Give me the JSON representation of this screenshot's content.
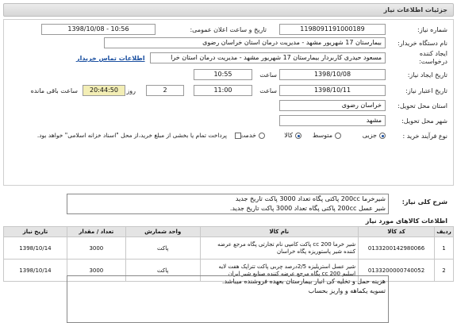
{
  "page_title": "جزئیات اطلاعات نیاز",
  "form": {
    "need_number": {
      "label": "شماره نیاز:",
      "value": "1198091191000189"
    },
    "announce_datetime": {
      "label": "تاریخ و ساعت اعلان عمومی:",
      "value": "1398/10/08 - 10:56"
    },
    "buyer_org": {
      "label": "نام دستگاه خریدار:",
      "value": "بیمارستان 17 شهریور مشهد - مدیریت درمان استان خراسان رضوی"
    },
    "requester": {
      "label_line1": "ایجاد کننده",
      "label_line2": "درخواست:",
      "value": "مسعود حیدری کاربردار بیمارستان 17 شهریور مشهد - مدیریت درمان استان خرا",
      "contact_link": "اطلاعات تماس خریدار"
    },
    "created": {
      "label": "تاریخ ایجاد نیاز:",
      "date": "1398/10/08",
      "time_label": "ساعت",
      "time": "10:55"
    },
    "deadline": {
      "label": "تاریخ اعتبار نیاز:",
      "date": "1398/10/11",
      "time_label": "ساعت",
      "time": "11:00",
      "days": "2",
      "days_label": "روز و",
      "remaining": "20:44:50",
      "remaining_label": "ساعت باقی مانده"
    },
    "province": {
      "label": "استان محل تحویل:",
      "value": "خراسان رضوی"
    },
    "city": {
      "label": "شهر محل تحویل:",
      "value": "مشهد"
    },
    "purchase_type": {
      "label": "نوع فرآیند خرید :",
      "options": [
        "جزیی",
        "متوسط"
      ],
      "selected": "جزیی",
      "payment_note": "پرداخت تمام یا بخشی از مبلغ خرید،از محل \"اسناد خزانه اسلامی\" خواهد بود."
    },
    "goods_type": {
      "options": [
        "کالا",
        "خدمت"
      ],
      "selected": "کالا"
    }
  },
  "general_desc": {
    "label": "شرح کلی نیاز:",
    "lines": [
      "شیرخرما 200cc پاکتی پگاه  تعداد 3000 پاکت تاریخ جدید",
      "شیر عسل 200cc  پاکتی پگاه تعداد 3000 پاکت تاریخ جدید."
    ]
  },
  "items_title": "اطلاعات کالاهای مورد نیاز",
  "items_table": {
    "headers": [
      "ردیف",
      "کد کالا",
      "نام کالا",
      "واحد شمارش",
      "تعداد / مقدار",
      "تاریخ نیاز"
    ],
    "rows": [
      {
        "row": "1",
        "code": "0133200142980066",
        "name_line1": "شیر خرما 200 cc پاکت کامپی نام تجارتی پگاه مرجع عرضه",
        "name_line2": "کننده شیر پاستوریزه پگاه خراسان",
        "unit": "پاکت",
        "qty": "3000",
        "date": "1398/10/14"
      },
      {
        "row": "2",
        "code": "0133200000740052",
        "name_line1": "شیر عسل استریلیزه 2/5درصد چربی پاکت تتراپک هفت لایه",
        "name_line2": "اسلیم 200 cc پگاه مرجع عرضه کننده صنایع شیر ایران",
        "unit": "پاکت",
        "qty": "3000",
        "date": "1398/10/14"
      }
    ]
  },
  "buyer_notes": {
    "lines": [
      "هزینه حمل و تخلیه کی انبار بیمارستان بعهده فروشنده میباشد.",
      "تسویه یکماهه و واریز بحساب"
    ]
  }
}
